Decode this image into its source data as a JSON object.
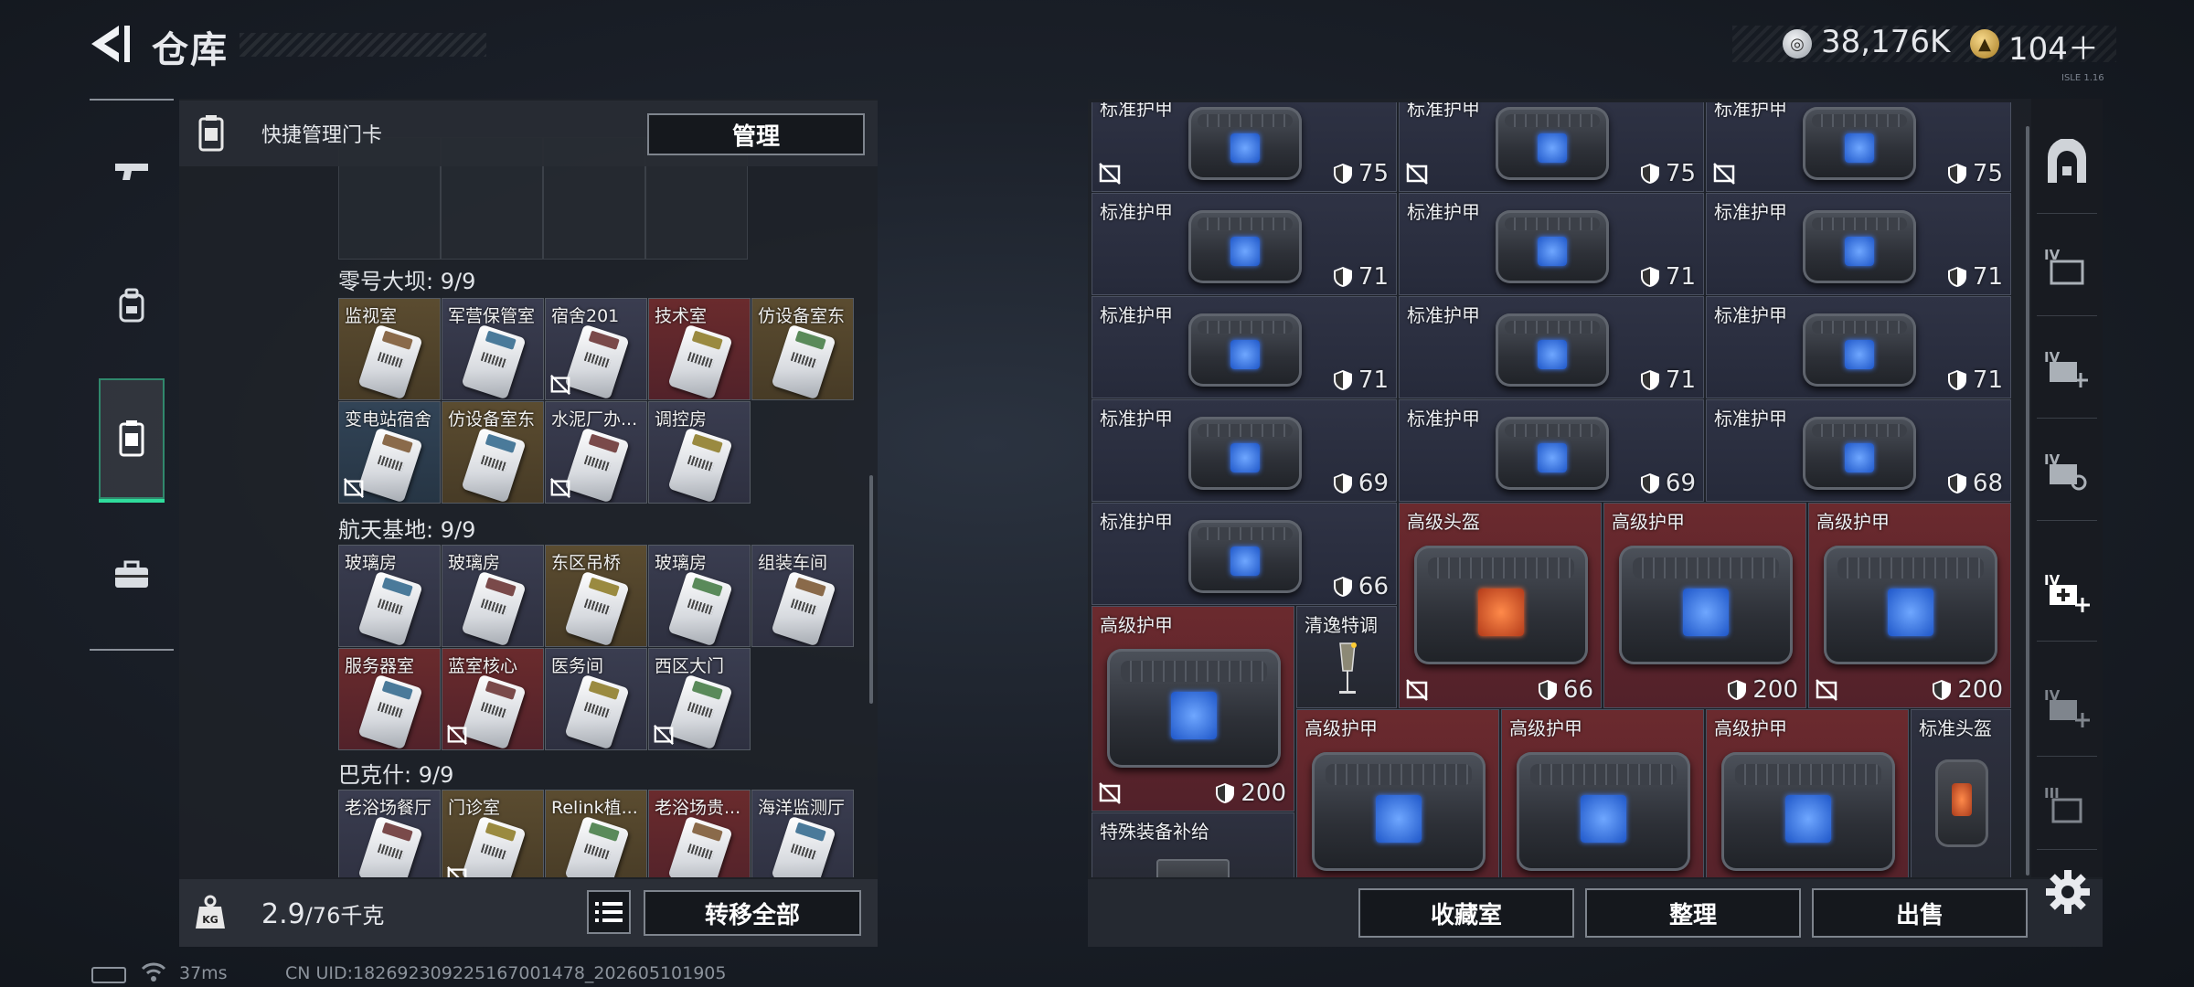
{
  "header": {
    "title": "仓库",
    "coin_value": "38,176K",
    "ticket_value": "104＋",
    "tiny_label": "ISLE 1.16"
  },
  "left_panel": {
    "header_label": "快捷管理门卡",
    "manage_label": "管理",
    "sections": [
      {
        "title": "零号大坝: 9/9",
        "cards": [
          {
            "name": "监视室",
            "color": "gold",
            "no_trade": false
          },
          {
            "name": "军营保管室",
            "color": "default",
            "no_trade": false
          },
          {
            "name": "宿舍201",
            "color": "default",
            "no_trade": true
          },
          {
            "name": "技术室",
            "color": "red",
            "no_trade": false
          },
          {
            "name": "仿设备室东",
            "color": "gold",
            "no_trade": false
          },
          {
            "name": "变电站宿舍",
            "color": "blue",
            "no_trade": true
          },
          {
            "name": "仿设备室东",
            "color": "gold",
            "no_trade": false
          },
          {
            "name": "水泥厂办...",
            "color": "default",
            "no_trade": true
          },
          {
            "name": "调控房",
            "color": "default",
            "no_trade": false
          }
        ]
      },
      {
        "title": "航天基地: 9/9",
        "cards": [
          {
            "name": "玻璃房",
            "color": "default",
            "no_trade": false
          },
          {
            "name": "玻璃房",
            "color": "default",
            "no_trade": false
          },
          {
            "name": "东区吊桥",
            "color": "gold",
            "no_trade": false
          },
          {
            "name": "玻璃房",
            "color": "default",
            "no_trade": false
          },
          {
            "name": "组装车间",
            "color": "default",
            "no_trade": false
          },
          {
            "name": "服务器室",
            "color": "red",
            "no_trade": false
          },
          {
            "name": "蓝室核心",
            "color": "red",
            "no_trade": true
          },
          {
            "name": "医务间",
            "color": "default",
            "no_trade": false
          },
          {
            "name": "西区大门",
            "color": "default",
            "no_trade": true
          }
        ]
      },
      {
        "title": "巴克什: 9/9",
        "cards": [
          {
            "name": "老浴场餐厅",
            "color": "default",
            "no_trade": false
          },
          {
            "name": "门诊室",
            "color": "gold",
            "no_trade": true
          },
          {
            "name": "Relink植...",
            "color": "gold",
            "no_trade": false
          },
          {
            "name": "老浴场贵...",
            "color": "red",
            "no_trade": false
          },
          {
            "name": "海洋监测厅",
            "color": "default",
            "no_trade": false
          }
        ]
      }
    ],
    "weight_current": "2.9",
    "weight_max": "/76千克",
    "transfer_label": "转移全部"
  },
  "inventory": {
    "items": [
      {
        "name": "标准护甲",
        "dur": "75",
        "quality": "blue",
        "no_trade": true
      },
      {
        "name": "标准护甲",
        "dur": "75",
        "quality": "blue",
        "no_trade": true
      },
      {
        "name": "标准护甲",
        "dur": "75",
        "quality": "blue",
        "no_trade": true
      },
      {
        "name": "标准护甲",
        "dur": "71",
        "quality": "blue",
        "no_trade": false
      },
      {
        "name": "标准护甲",
        "dur": "71",
        "quality": "blue",
        "no_trade": false
      },
      {
        "name": "标准护甲",
        "dur": "71",
        "quality": "blue",
        "no_trade": false
      },
      {
        "name": "标准护甲",
        "dur": "71",
        "quality": "blue",
        "no_trade": false
      },
      {
        "name": "标准护甲",
        "dur": "71",
        "quality": "blue",
        "no_trade": false
      },
      {
        "name": "标准护甲",
        "dur": "71",
        "quality": "blue",
        "no_trade": false
      },
      {
        "name": "标准护甲",
        "dur": "69",
        "quality": "blue",
        "no_trade": false
      },
      {
        "name": "标准护甲",
        "dur": "69",
        "quality": "blue",
        "no_trade": false
      },
      {
        "name": "标准护甲",
        "dur": "68",
        "quality": "blue",
        "no_trade": false
      },
      {
        "name": "标准护甲",
        "dur": "66",
        "quality": "blue",
        "no_trade": false
      },
      {
        "name": "高级头盔",
        "dur": "66",
        "quality": "red",
        "no_trade": true
      },
      {
        "name": "高级护甲",
        "dur": "200",
        "quality": "red",
        "no_trade": false
      },
      {
        "name": "高级护甲",
        "dur": "200",
        "quality": "red",
        "no_trade": true
      },
      {
        "name": "高级护甲",
        "dur": "200",
        "quality": "red",
        "no_trade": true
      },
      {
        "name": "清逸特调",
        "dur": "",
        "quality": "grey",
        "no_trade": false
      },
      {
        "name": "高级护甲",
        "dur": "",
        "quality": "red",
        "no_trade": false
      },
      {
        "name": "高级护甲",
        "dur": "",
        "quality": "red",
        "no_trade": false
      },
      {
        "name": "高级护甲",
        "dur": "",
        "quality": "red",
        "no_trade": false
      },
      {
        "name": "标准头盔",
        "dur": "",
        "quality": "grey",
        "no_trade": false
      },
      {
        "name": "特殊装备补给",
        "dur": "",
        "quality": "grey",
        "no_trade": false
      }
    ],
    "collect_label": "收藏室",
    "sort_label": "整理",
    "sell_label": "出售"
  },
  "rail": {
    "tier_label": "IV",
    "tier_label_3": "III"
  },
  "status": {
    "ping": "37ms",
    "uid": "CN UID:182692309225167001478_202605101905"
  },
  "colors": {
    "accent_green": "#2fdc9c",
    "card_gold": "#5b4c30",
    "card_red": "#6a2b2d",
    "card_blue": "#324457",
    "quality_red": "#6b2a2e"
  }
}
